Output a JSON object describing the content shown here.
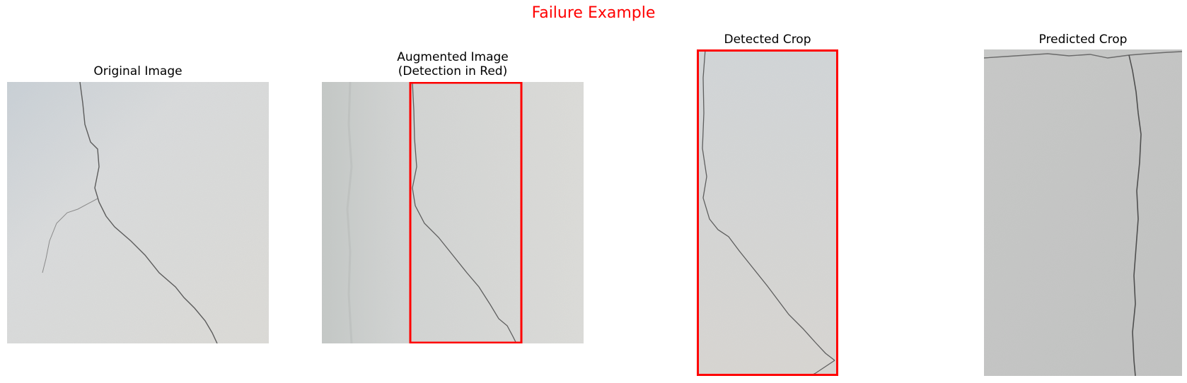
{
  "figure": {
    "suptitle": "Failure Example",
    "suptitle_color": "#ff0000",
    "detection_box_color": "#ff0000"
  },
  "panels": [
    {
      "title": "Original Image",
      "content": "concrete wall with diagonal crack"
    },
    {
      "title": "Augmented Image\n(Detection in Red)",
      "content": "mirrored concrete wall with detection box"
    },
    {
      "title": "Detected Crop",
      "content": "crop of detected region, red border"
    },
    {
      "title": "Predicted Crop",
      "content": "concrete wall with vertical crack"
    }
  ]
}
